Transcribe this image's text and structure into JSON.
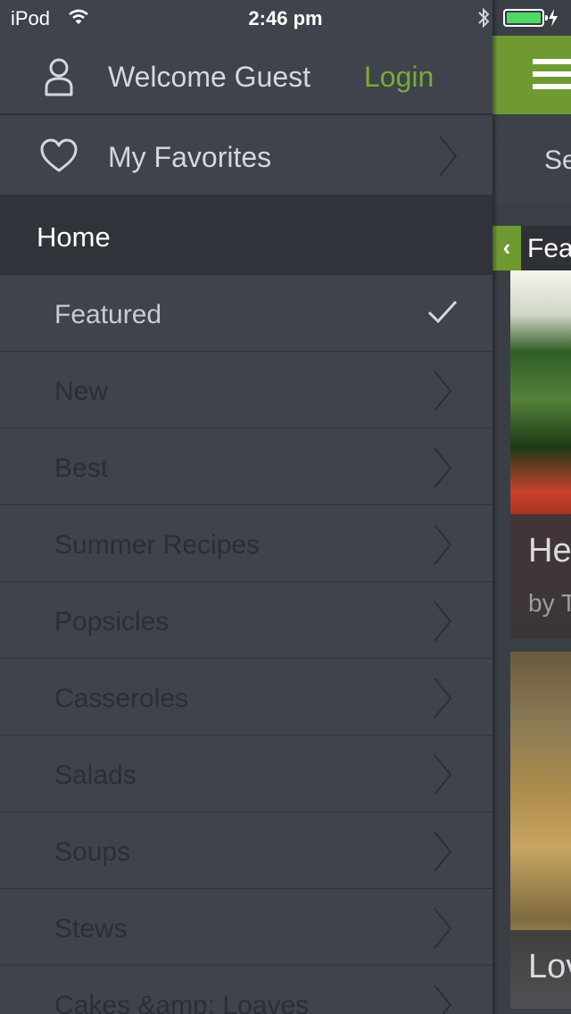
{
  "status_bar": {
    "carrier": "iPod",
    "time": "2:46 pm",
    "battery_color": "#4cd964"
  },
  "drawer": {
    "welcome_text": "Welcome Guest",
    "login_label": "Login",
    "favorites_label": "My Favorites",
    "section_title": "Home",
    "items": [
      {
        "label": "Featured",
        "selected": true
      },
      {
        "label": "New"
      },
      {
        "label": "Best"
      },
      {
        "label": "Summer Recipes"
      },
      {
        "label": "Popsicles"
      },
      {
        "label": "Casseroles"
      },
      {
        "label": "Salads"
      },
      {
        "label": "Soups"
      },
      {
        "label": "Stews"
      },
      {
        "label": "Cakes &amp; Loaves"
      }
    ]
  },
  "main": {
    "search_text": "Se",
    "featured_label": "Fea",
    "cards": [
      {
        "title": "He",
        "byline": "by T"
      },
      {
        "title": "Lov"
      }
    ]
  },
  "colors": {
    "accent_green": "#6f9a32",
    "login_green": "#7aab34",
    "drawer_bg": "#3f434b",
    "section_bg": "#30333a"
  },
  "icons": {
    "user": "user-icon",
    "heart": "heart-icon",
    "chevron": "chevron-right-icon",
    "check": "checkmark-icon",
    "menu": "hamburger-icon",
    "back": "back-arrow-icon"
  }
}
